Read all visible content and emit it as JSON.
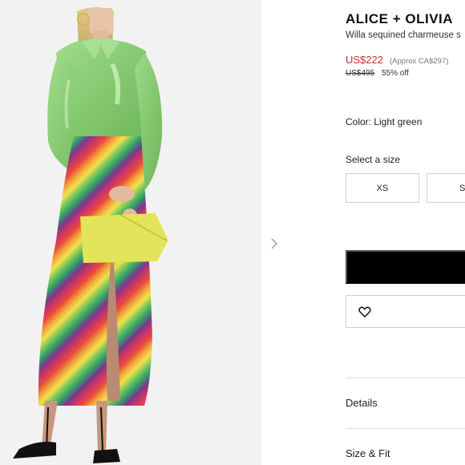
{
  "product": {
    "brand": "ALICE + OLIVIA",
    "name": "Willa sequined charmeuse s",
    "price": "US$222",
    "approx_price": "(Approx CA$297)",
    "original_price": "US$495",
    "discount": "55% off",
    "color_label": "Color: Light green"
  },
  "sizes": {
    "label": "Select a size",
    "options": [
      "XS",
      "S"
    ]
  },
  "sections": {
    "details": "Details",
    "size_fit": "Size & Fit"
  },
  "colors": {
    "price_red": "#c0322b",
    "button_black": "#000000",
    "blouse_green": "#8fd27a"
  },
  "icons": {
    "next": "chevron-right-icon",
    "wishlist": "heart-icon"
  }
}
